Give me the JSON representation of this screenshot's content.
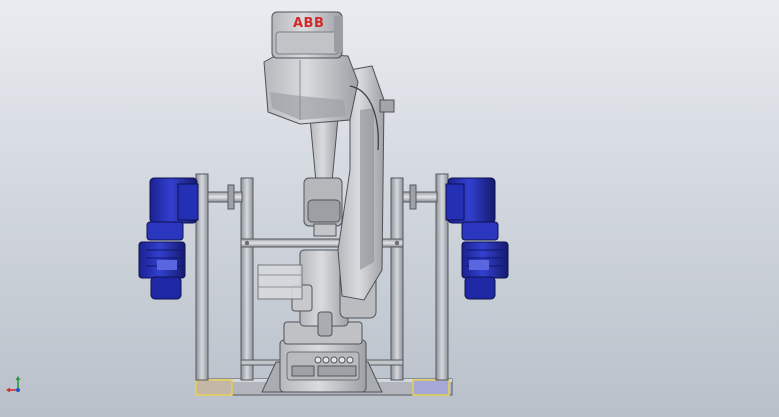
{
  "scene": {
    "robot_brand": "ABB",
    "colors": {
      "background_top": "#e9ecf0",
      "background_bottom": "#b9c0c9",
      "robot_body": "#c9cacd",
      "robot_shadow": "#8d9096",
      "frame_steel": "#b8bcc2",
      "frame_edge": "#55595f",
      "motor_blue": "#2a33b8",
      "motor_dark": "#141a6e",
      "selection_yellow": "#e8d34a",
      "base_pad_left": "#c5b7a8",
      "base_pad_right": "#a6a9d8"
    }
  },
  "view_triad": {
    "icon": "xyz-axis-triad-icon",
    "axis_x_color": "#d0302a",
    "axis_y_color": "#2a9a3a",
    "axis_z_color": "#2a52c8"
  }
}
